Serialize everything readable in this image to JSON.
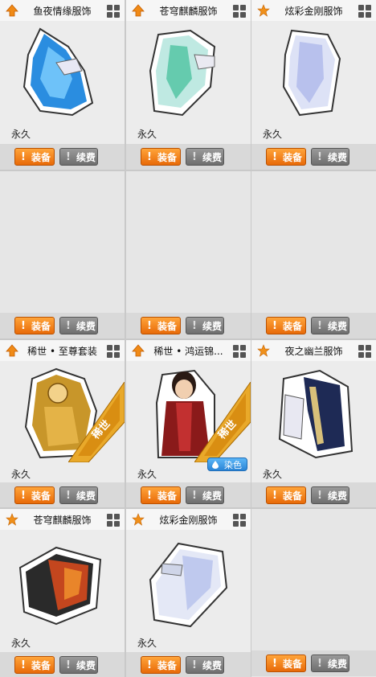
{
  "cards": [
    {
      "title": "鱼夜情缘服饰",
      "icon": "up-arrow-icon",
      "duration": "永久",
      "equip": "装备",
      "renew": "续费"
    },
    {
      "title": "苍穹麒麟服饰",
      "icon": "up-arrow-icon",
      "duration": "永久",
      "equip": "装备",
      "renew": "续费"
    },
    {
      "title": "炫彩金刚服饰",
      "icon": "star-icon",
      "duration": "永久",
      "equip": "装备",
      "renew": "续费"
    },
    {
      "title": "稀世 • 至尊套装",
      "icon": "up-arrow-icon",
      "duration": "永久",
      "equip": "装备",
      "renew": "续费",
      "badge": "稀世"
    },
    {
      "title": "稀世 • 鸿运锦...",
      "icon": "up-arrow-icon",
      "duration": "永久",
      "equip": "装备",
      "renew": "续费",
      "badge": "稀世",
      "dye": "染色"
    },
    {
      "title": "夜之幽兰服饰",
      "icon": "star-icon",
      "duration": "永久",
      "equip": "装备",
      "renew": "续费"
    },
    {
      "title": "苍穹麒麟服饰",
      "icon": "star-icon",
      "duration": "永久",
      "equip": "装备",
      "renew": "续费"
    },
    {
      "title": "炫彩金刚服饰",
      "icon": "star-icon",
      "duration": "永久",
      "equip": "装备",
      "renew": "续费"
    }
  ],
  "empty_row": {
    "equip": "装备",
    "renew": "续费"
  },
  "last_empty": {
    "equip": "装备",
    "renew": "续费"
  },
  "colors": {
    "accent": "#f07a10",
    "renew": "#7a7a7a",
    "dye": "#3a96e6",
    "badge_gold": "#e9a92a"
  }
}
